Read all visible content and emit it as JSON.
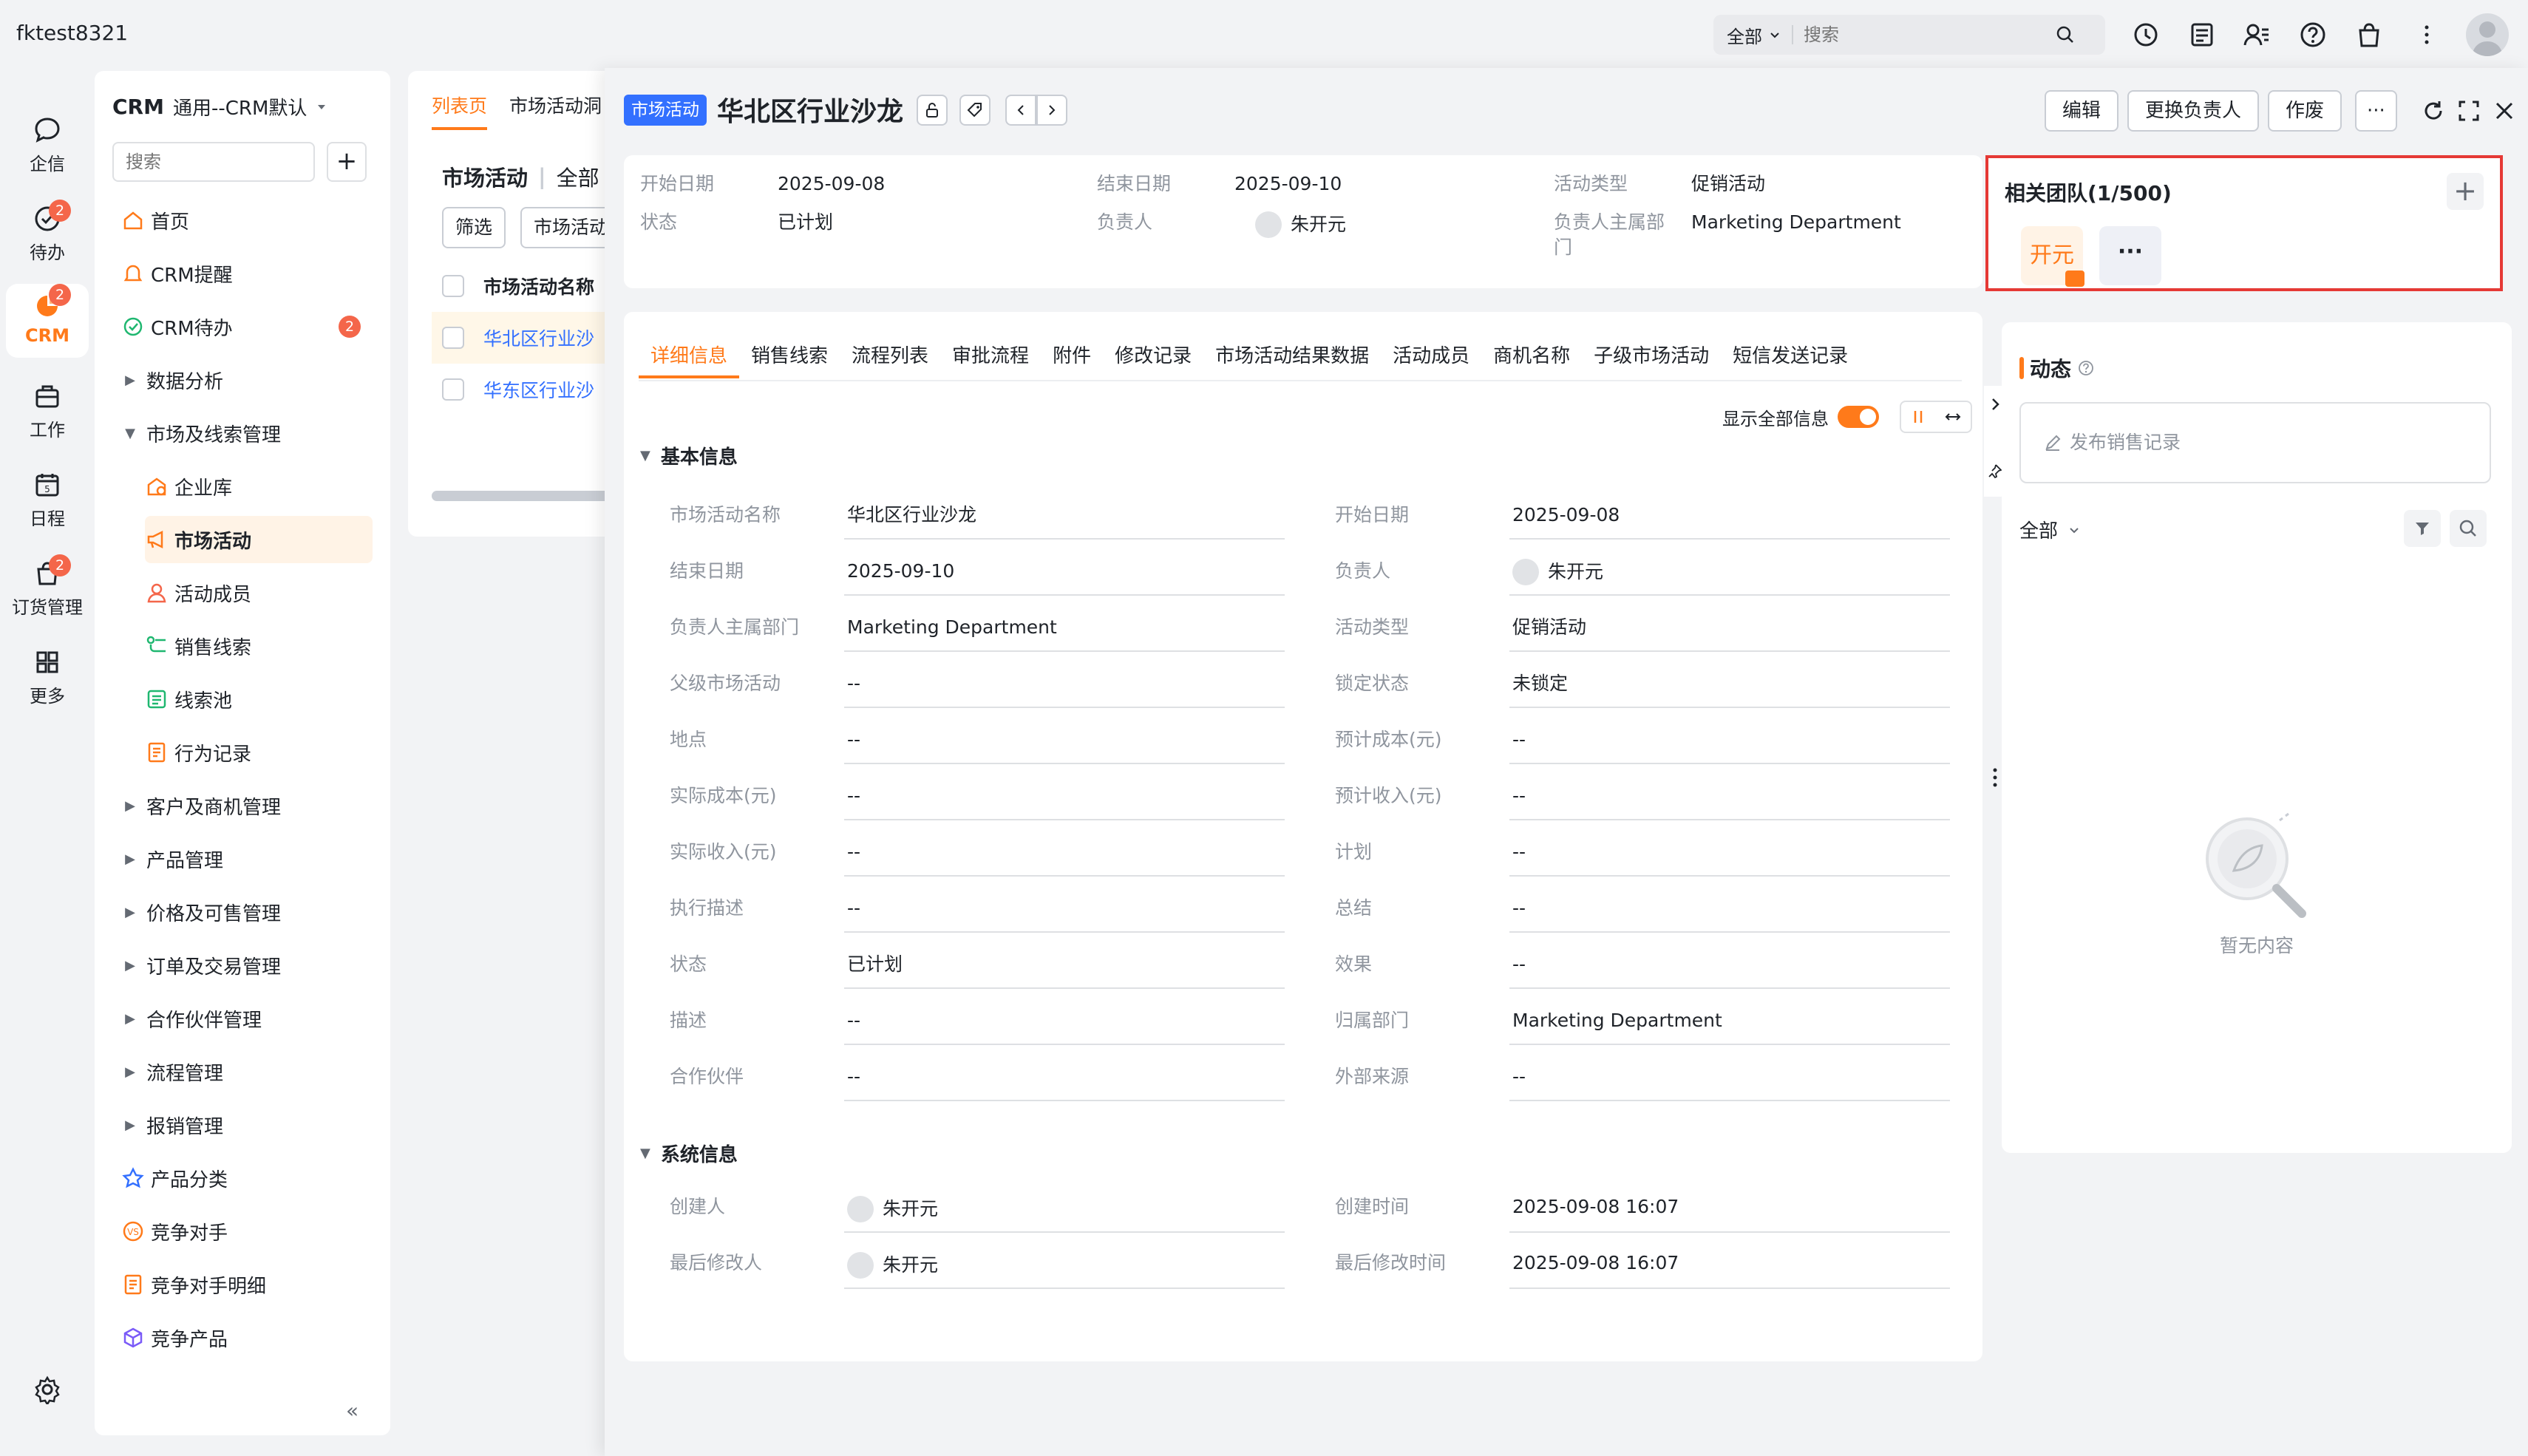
{
  "topbar": {
    "tenant": "fktest8321",
    "search_scope": "全部",
    "search_placeholder": "搜索"
  },
  "rail": {
    "items": [
      {
        "label": "企信",
        "badge": ""
      },
      {
        "label": "待办",
        "badge": "2"
      },
      {
        "label": "CRM",
        "badge": "2"
      },
      {
        "label": "工作",
        "badge": ""
      },
      {
        "label": "日程",
        "badge": ""
      },
      {
        "label": "订货管理",
        "badge": "2"
      },
      {
        "label": "更多",
        "badge": ""
      }
    ]
  },
  "nav": {
    "title": "CRM",
    "subtitle": "通用--CRM默认",
    "search_placeholder": "搜索",
    "add_label": "+",
    "items": [
      {
        "label": "首页"
      },
      {
        "label": "CRM提醒"
      },
      {
        "label": "CRM待办",
        "badge": "2"
      },
      {
        "label": "数据分析"
      },
      {
        "label": "市场及线索管理"
      },
      {
        "label": "企业库"
      },
      {
        "label": "市场活动"
      },
      {
        "label": "活动成员"
      },
      {
        "label": "销售线索"
      },
      {
        "label": "线索池"
      },
      {
        "label": "行为记录"
      },
      {
        "label": "客户及商机管理"
      },
      {
        "label": "产品管理"
      },
      {
        "label": "价格及可售管理"
      },
      {
        "label": "订单及交易管理"
      },
      {
        "label": "合作伙伴管理"
      },
      {
        "label": "流程管理"
      },
      {
        "label": "报销管理"
      },
      {
        "label": "产品分类"
      },
      {
        "label": "竞争对手"
      },
      {
        "label": "竞争对手明细"
      },
      {
        "label": "竞争产品"
      }
    ],
    "collapse_label": "«"
  },
  "list": {
    "tabs": [
      "列表页",
      "市场活动洞"
    ],
    "heading": "市场活动",
    "scope": "全部",
    "filter_label": "筛选",
    "type_label": "市场活动",
    "column": "市场活动名称",
    "rows": [
      "华北区行业沙",
      "华东区行业沙"
    ]
  },
  "record": {
    "type_tag": "市场活动",
    "title": "华北区行业沙龙",
    "actions": {
      "edit": "编辑",
      "change_owner": "更换负责人",
      "void": "作废",
      "more": "···"
    }
  },
  "summary": [
    {
      "label": "开始日期",
      "value": "2025-09-08"
    },
    {
      "label": "结束日期",
      "value": "2025-09-10"
    },
    {
      "label": "活动类型",
      "value": "促销活动"
    },
    {
      "label": "状态",
      "value": "已计划"
    },
    {
      "label": "负责人",
      "value": "朱开元"
    },
    {
      "label": "负责人主属部门",
      "value": "Marketing Department"
    }
  ],
  "tabs": [
    "详细信息",
    "销售线索",
    "流程列表",
    "审批流程",
    "附件",
    "修改记录",
    "市场活动结果数据",
    "活动成员",
    "商机名称",
    "子级市场活动",
    "短信发送记录"
  ],
  "detail": {
    "show_all_label": "显示全部信息",
    "basic_title": "基本信息",
    "basic_fields": [
      {
        "label": "市场活动名称",
        "value": "华北区行业沙龙"
      },
      {
        "label": "开始日期",
        "value": "2025-09-08"
      },
      {
        "label": "结束日期",
        "value": "2025-09-10"
      },
      {
        "label": "负责人",
        "value": "朱开元"
      },
      {
        "label": "负责人主属部门",
        "value": "Marketing Department"
      },
      {
        "label": "活动类型",
        "value": "促销活动"
      },
      {
        "label": "父级市场活动",
        "value": "--"
      },
      {
        "label": "锁定状态",
        "value": "未锁定"
      },
      {
        "label": "地点",
        "value": "--"
      },
      {
        "label": "预计成本(元)",
        "value": "--"
      },
      {
        "label": "实际成本(元)",
        "value": "--"
      },
      {
        "label": "预计收入(元)",
        "value": "--"
      },
      {
        "label": "实际收入(元)",
        "value": "--"
      },
      {
        "label": "计划",
        "value": "--"
      },
      {
        "label": "执行描述",
        "value": "--"
      },
      {
        "label": "总结",
        "value": "--"
      },
      {
        "label": "状态",
        "value": "已计划"
      },
      {
        "label": "效果",
        "value": "--"
      },
      {
        "label": "描述",
        "value": "--"
      },
      {
        "label": "归属部门",
        "value": "Marketing Department"
      },
      {
        "label": "合作伙伴",
        "value": "--"
      },
      {
        "label": "外部来源",
        "value": "--"
      }
    ],
    "system_title": "系统信息",
    "system_fields": [
      {
        "label": "创建人",
        "value": "朱开元"
      },
      {
        "label": "创建时间",
        "value": "2025-09-08 16:07"
      },
      {
        "label": "最后修改人",
        "value": "朱开元"
      },
      {
        "label": "最后修改时间",
        "value": "2025-09-08 16:07"
      }
    ]
  },
  "team": {
    "title": "相关团队(1/500)",
    "add_label": "+",
    "member": "开元",
    "more": "···"
  },
  "feed": {
    "title": "动态",
    "post_placeholder": "发布销售记录",
    "filter": "全部",
    "empty": "暂无内容"
  },
  "colors": {
    "accent": "#ff7a1a",
    "tag_blue": "#3370ff",
    "badge_red": "#f4664a",
    "highlight_border": "#e53935"
  }
}
